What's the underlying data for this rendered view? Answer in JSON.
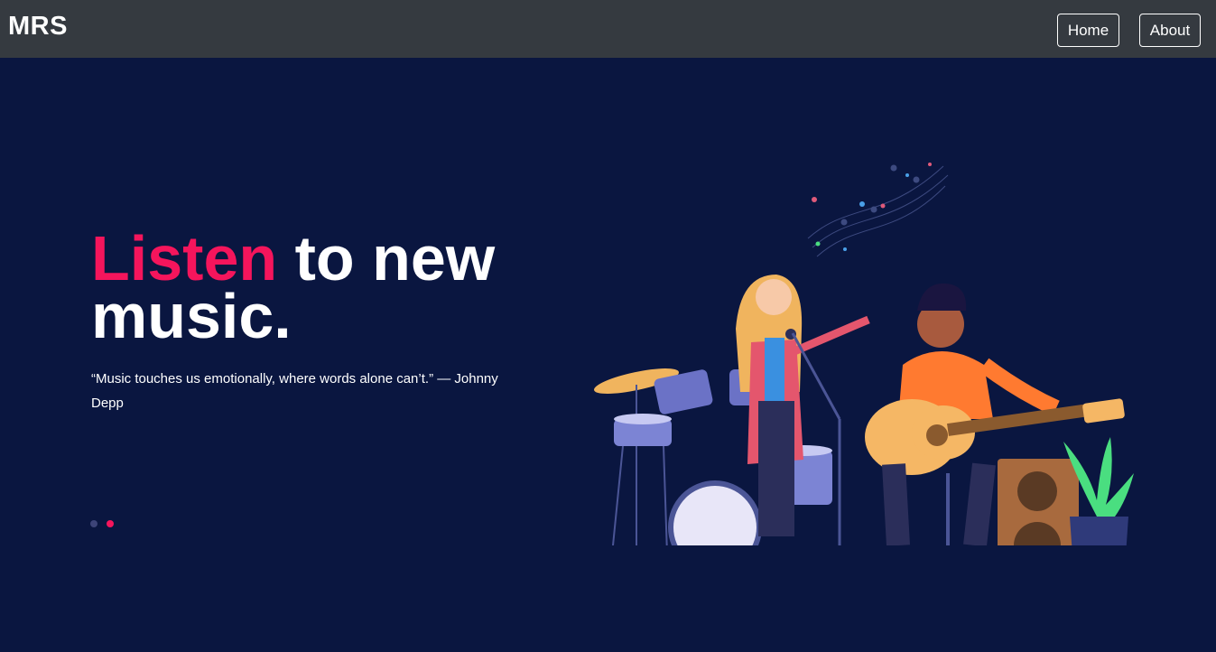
{
  "navbar": {
    "brand": "MRS",
    "links": [
      {
        "label": "Home"
      },
      {
        "label": "About"
      }
    ]
  },
  "hero": {
    "headline_accent": "Listen",
    "headline_rest": " to new music.",
    "quote": "“Music touches us emotionally, where words alone can’t.” — Johnny Depp",
    "slides": {
      "count": 2,
      "active_index": 1
    }
  },
  "colors": {
    "navbar_bg": "#353a40",
    "hero_bg": "#0a1640",
    "accent": "#f5155c",
    "text": "#ffffff"
  }
}
